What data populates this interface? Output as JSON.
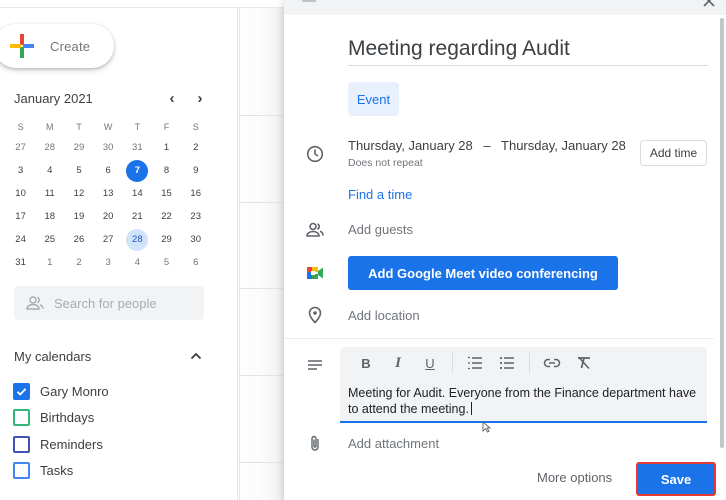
{
  "sidebar": {
    "create_label": "Create",
    "mini_calendar": {
      "month_label": "January 2021",
      "prev_icon": "chevron-left-icon",
      "next_icon": "chevron-right-icon",
      "weekdays": [
        "S",
        "M",
        "T",
        "W",
        "T",
        "F",
        "S"
      ],
      "weeks": [
        [
          {
            "d": "27",
            "o": true
          },
          {
            "d": "28",
            "o": true
          },
          {
            "d": "29",
            "o": true
          },
          {
            "d": "30",
            "o": true
          },
          {
            "d": "31",
            "o": true
          },
          {
            "d": "1"
          },
          {
            "d": "2"
          }
        ],
        [
          {
            "d": "3"
          },
          {
            "d": "4"
          },
          {
            "d": "5"
          },
          {
            "d": "6"
          },
          {
            "d": "7",
            "today": true
          },
          {
            "d": "8"
          },
          {
            "d": "9"
          }
        ],
        [
          {
            "d": "10"
          },
          {
            "d": "11"
          },
          {
            "d": "12"
          },
          {
            "d": "13"
          },
          {
            "d": "14"
          },
          {
            "d": "15"
          },
          {
            "d": "16"
          }
        ],
        [
          {
            "d": "17"
          },
          {
            "d": "18"
          },
          {
            "d": "19"
          },
          {
            "d": "20"
          },
          {
            "d": "21"
          },
          {
            "d": "22"
          },
          {
            "d": "23"
          }
        ],
        [
          {
            "d": "24"
          },
          {
            "d": "25"
          },
          {
            "d": "26"
          },
          {
            "d": "27"
          },
          {
            "d": "28",
            "selected": true
          },
          {
            "d": "29"
          },
          {
            "d": "30"
          }
        ],
        [
          {
            "d": "31"
          },
          {
            "d": "1",
            "o": true
          },
          {
            "d": "2",
            "o": true
          },
          {
            "d": "3",
            "o": true
          },
          {
            "d": "4",
            "o": true
          },
          {
            "d": "5",
            "o": true
          },
          {
            "d": "6",
            "o": true
          }
        ]
      ]
    },
    "search_people_placeholder": "Search for people",
    "my_calendars_label": "My calendars",
    "calendars": [
      {
        "name": "Gary Monro",
        "checked": true,
        "color": "#1a73e8"
      },
      {
        "name": "Birthdays",
        "checked": false,
        "color": "#33b679"
      },
      {
        "name": "Reminders",
        "checked": false,
        "color": "#3f51b5"
      },
      {
        "name": "Tasks",
        "checked": false,
        "color": "#4285f4"
      }
    ]
  },
  "dialog": {
    "title_value": "Meeting regarding Audit",
    "event_type_label": "Event",
    "start_date": "Thursday, January 28",
    "date_separator": "–",
    "end_date": "Thursday, January 28",
    "repeat_label": "Does not repeat",
    "add_time_label": "Add time",
    "find_time_label": "Find a time",
    "add_guests_label": "Add guests",
    "meet_button_label": "Add Google Meet video conferencing",
    "add_location_label": "Add location",
    "toolbar": {
      "bold": "B",
      "italic": "I",
      "underline": "U"
    },
    "description_text": "Meeting for Audit. Everyone from the Finance department have to attend the meeting.",
    "add_attachment_label": "Add attachment",
    "more_options_label": "More options",
    "save_label": "Save",
    "colors": {
      "accent": "#1a73e8",
      "highlight_border": "#e53935"
    }
  }
}
